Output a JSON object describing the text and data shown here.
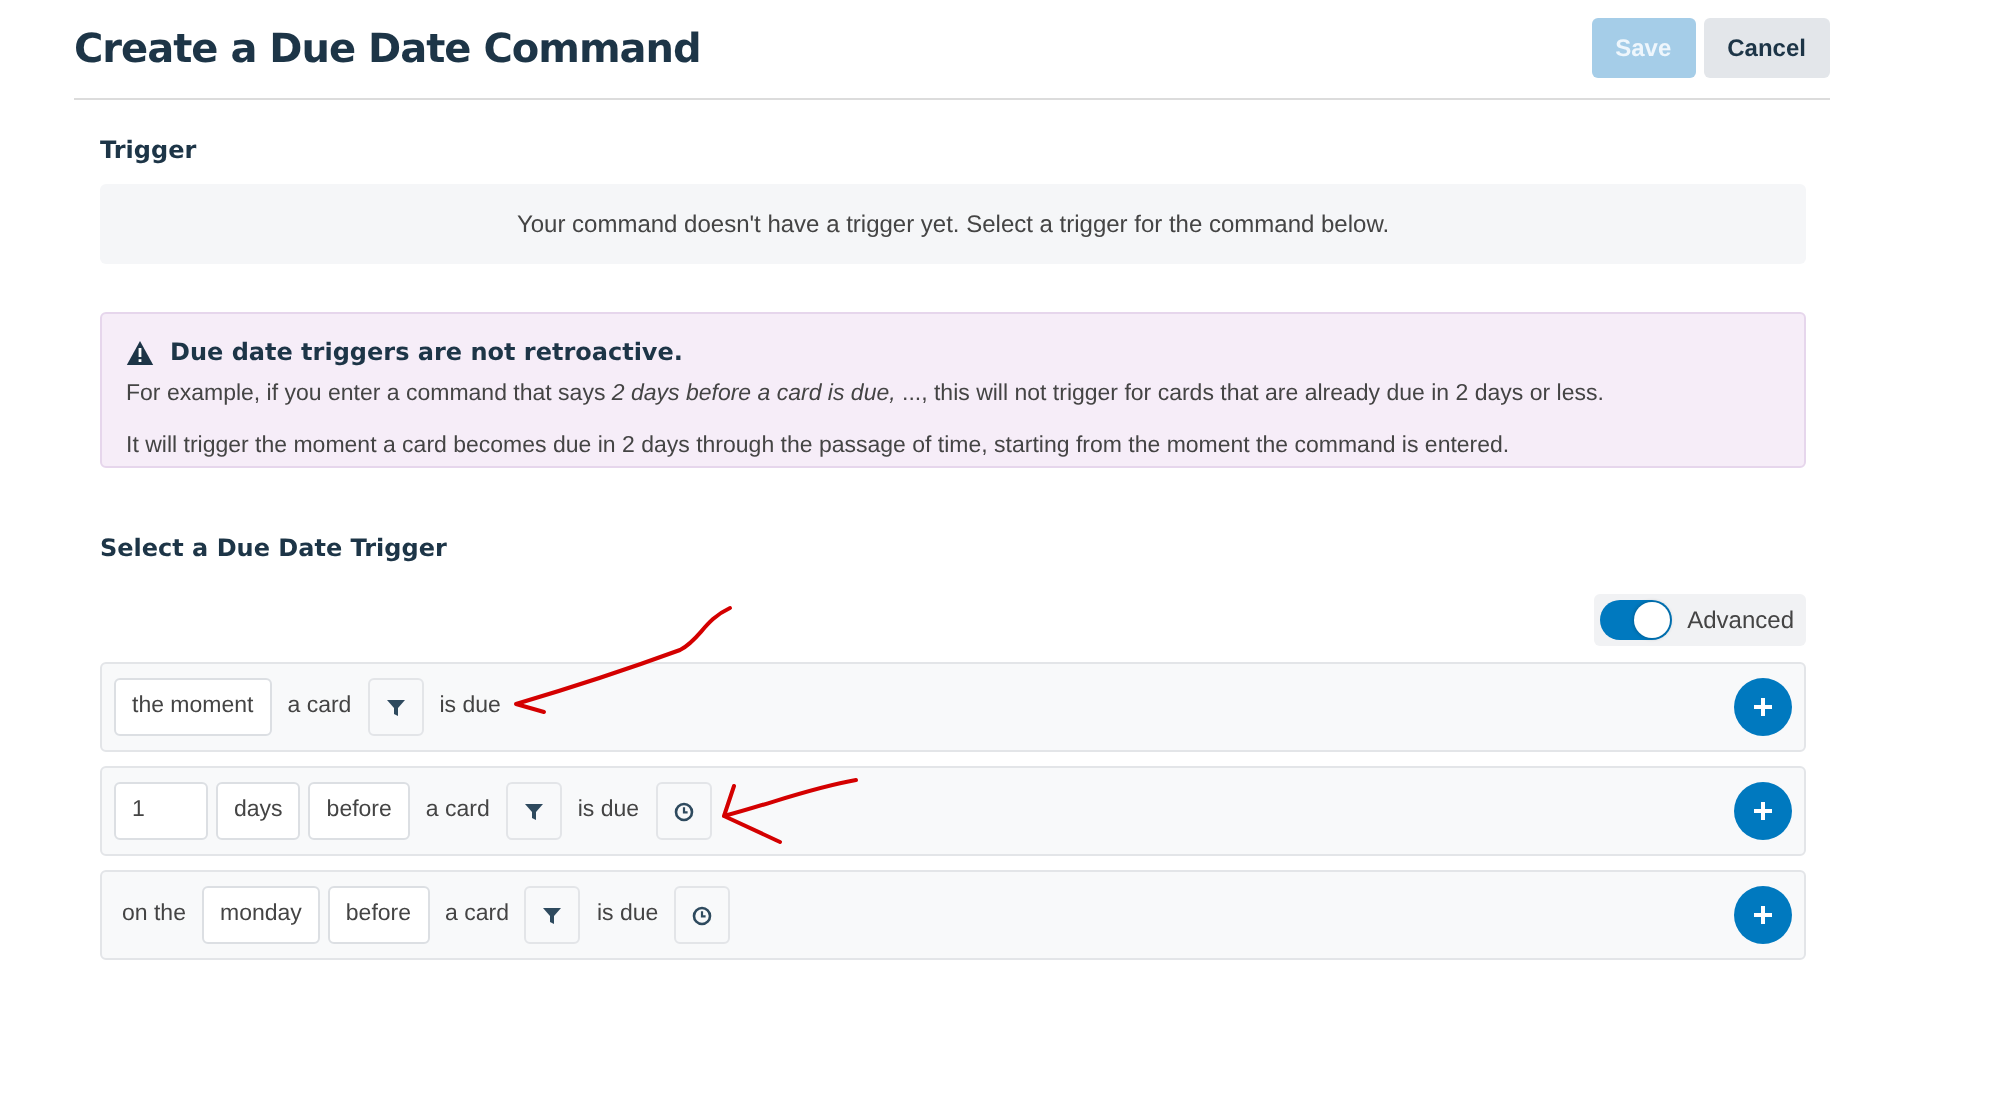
{
  "header": {
    "title": "Create a Due Date Command",
    "buttons": [
      {
        "label": "Save",
        "kind": "primary",
        "disabled": true
      },
      {
        "label": "Cancel",
        "kind": "secondary",
        "disabled": false
      }
    ]
  },
  "trigger": {
    "heading": "Trigger",
    "empty_message": "Your command doesn't have a trigger yet. Select a trigger for the command below."
  },
  "notice": {
    "title": "Due date triggers are not retroactive.",
    "paragraphs": [
      "For example, if you enter a command that says *2 days before a card is due,* ..., this will not trigger for cards that are already due in 2 days or less.",
      "It will trigger the moment a card becomes due in 2 days through the passage of time, starting from the moment the command is entered."
    ]
  },
  "select": {
    "heading": "Select a Due Date Trigger",
    "advanced": {
      "label": "Advanced",
      "on": true
    },
    "rows": [
      {
        "parts": [
          {
            "kind": "field",
            "text": "the moment"
          },
          {
            "kind": "text",
            "text": "a card"
          },
          {
            "kind": "filter"
          },
          {
            "kind": "text",
            "text": "is due"
          }
        ]
      },
      {
        "parts": [
          {
            "kind": "input",
            "text": "1"
          },
          {
            "kind": "field",
            "text": "days"
          },
          {
            "kind": "field",
            "text": "before"
          },
          {
            "kind": "text",
            "text": "a card"
          },
          {
            "kind": "filter"
          },
          {
            "kind": "text",
            "text": "is due"
          },
          {
            "kind": "clock"
          }
        ]
      },
      {
        "parts": [
          {
            "kind": "text",
            "text": "on the"
          },
          {
            "kind": "field",
            "text": "monday"
          },
          {
            "kind": "field",
            "text": "before"
          },
          {
            "kind": "text",
            "text": "a card"
          },
          {
            "kind": "filter"
          },
          {
            "kind": "text",
            "text": "is due"
          },
          {
            "kind": "clock"
          }
        ]
      }
    ]
  }
}
